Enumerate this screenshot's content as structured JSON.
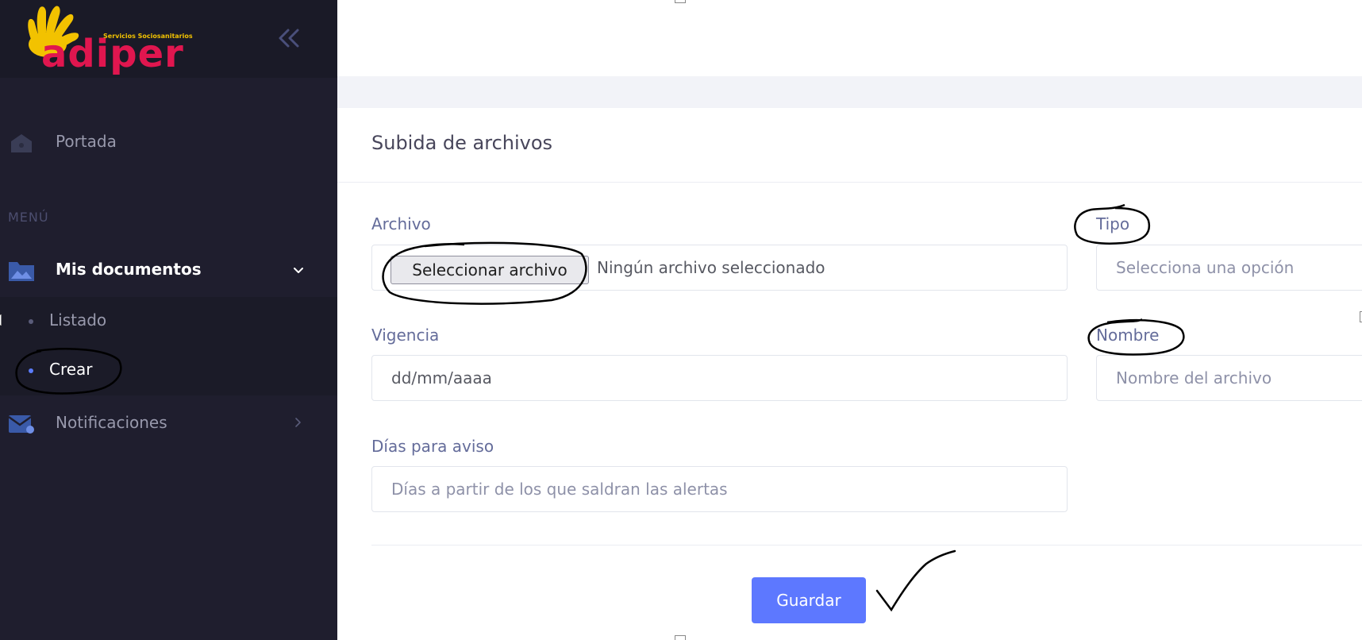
{
  "brand": {
    "name": "adiper",
    "tagline": "Servicios Sociosanitarios"
  },
  "sidebar": {
    "home": {
      "label": "Portada",
      "icon": "home-icon"
    },
    "menu_heading": "MENÚ",
    "documents": {
      "label": "Mis documentos",
      "icon": "folder-icon",
      "expanded": true,
      "children": [
        {
          "label": "Listado"
        },
        {
          "label": "Crear",
          "active": true
        }
      ]
    },
    "notifications": {
      "label": "Notificaciones",
      "icon": "mail-icon"
    }
  },
  "form": {
    "title": "Subida de archivos",
    "file": {
      "label": "Archivo",
      "button_label": "Seleccionar archivo",
      "status": "Ningún archivo seleccionado"
    },
    "type": {
      "label": "Tipo",
      "placeholder": "Selecciona una opción"
    },
    "validity": {
      "label": "Vigencia",
      "value": "dd/mm/aaaa"
    },
    "name": {
      "label": "Nombre",
      "placeholder": "Nombre del archivo"
    },
    "notice_days": {
      "label": "Días para aviso",
      "placeholder": "Días a partir de los que saldran las alertas"
    },
    "submit_label": "Guardar"
  },
  "colors": {
    "sidebar_bg": "#1f1e2e",
    "accent": "#5d78ff",
    "brand_yellow": "#f2c200",
    "brand_red": "#e0164f"
  }
}
